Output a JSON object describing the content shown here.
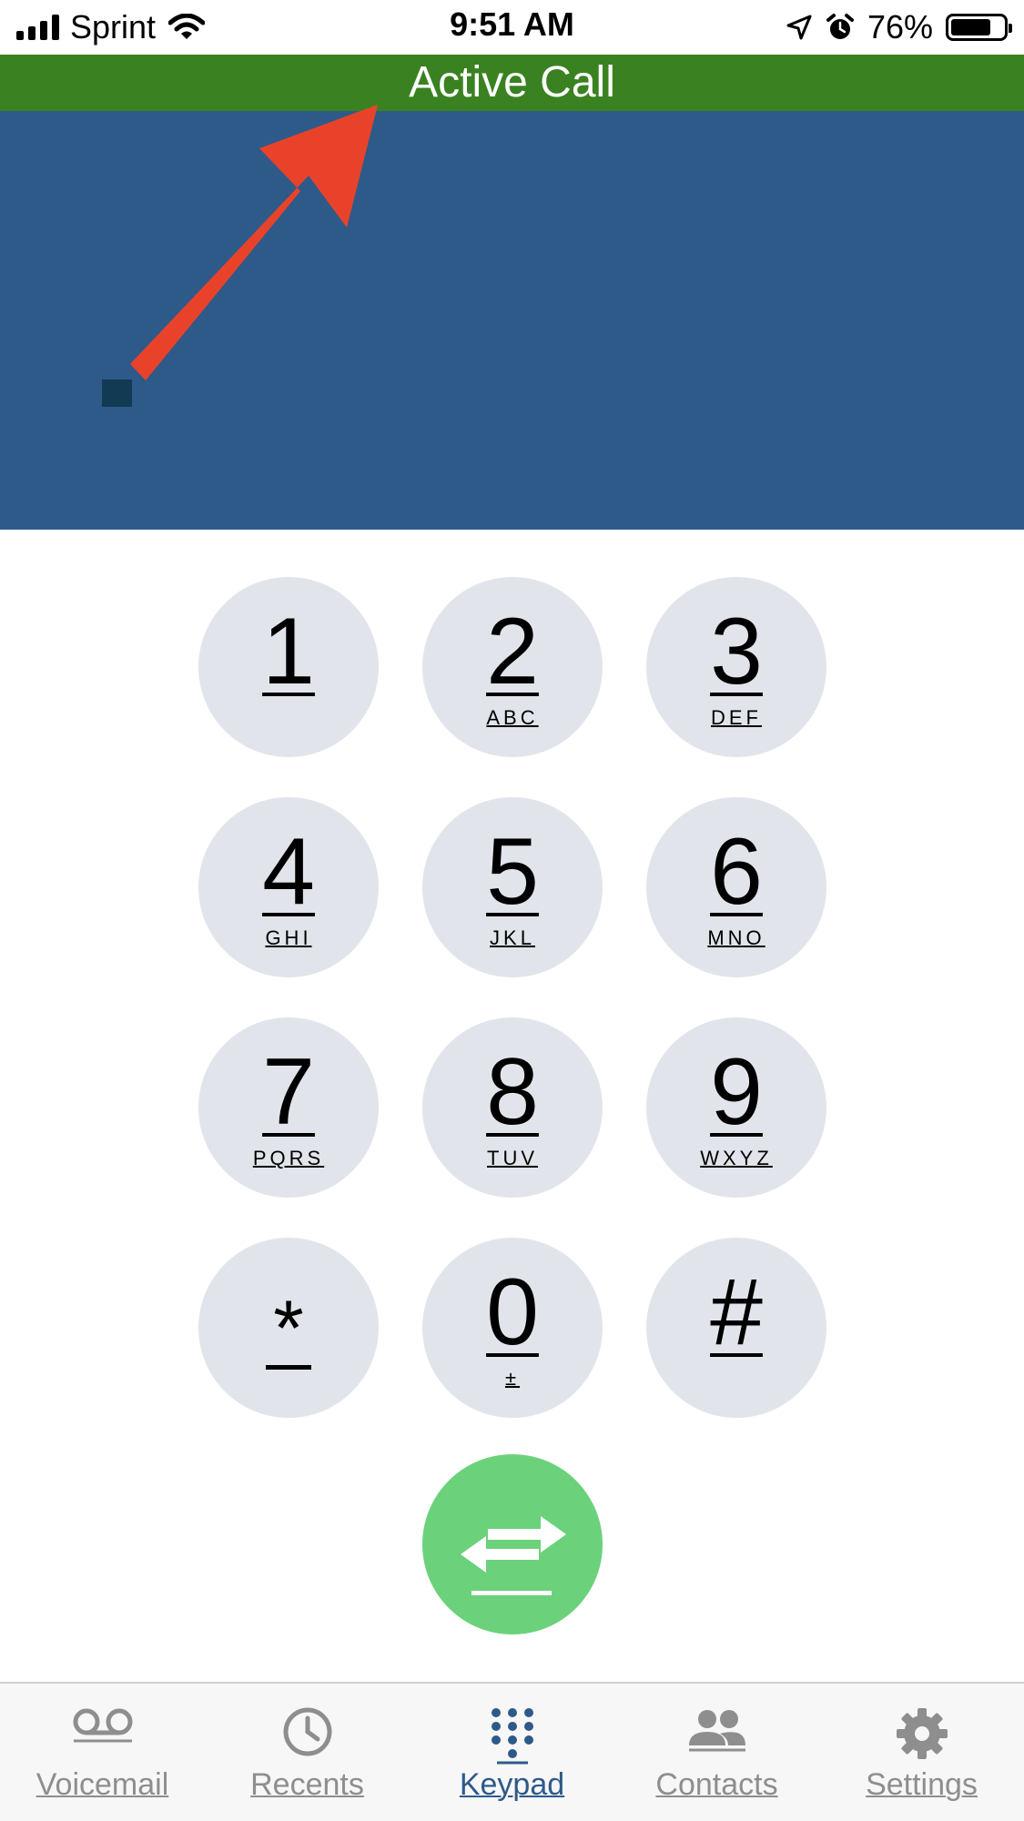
{
  "status_bar": {
    "carrier": "Sprint",
    "time": "9:51 AM",
    "battery_percent": "76%",
    "battery_level": 0.76,
    "icons": [
      "signal-icon",
      "wifi-icon",
      "location-arrow-icon",
      "alarm-icon",
      "battery-icon"
    ]
  },
  "banner": {
    "title": "Active Call",
    "color": "#3a8221"
  },
  "call_panel": {
    "color": "#2e5a89",
    "annotation_color": "#e8432a"
  },
  "keypad": {
    "keys": [
      {
        "digit": "1",
        "letters": ""
      },
      {
        "digit": "2",
        "letters": "ABC"
      },
      {
        "digit": "3",
        "letters": "DEF"
      },
      {
        "digit": "4",
        "letters": "GHI"
      },
      {
        "digit": "5",
        "letters": "JKL"
      },
      {
        "digit": "6",
        "letters": "MNO"
      },
      {
        "digit": "7",
        "letters": "PQRS"
      },
      {
        "digit": "8",
        "letters": "TUV"
      },
      {
        "digit": "9",
        "letters": "WXYZ"
      },
      {
        "digit": "*",
        "letters": ""
      },
      {
        "digit": "0",
        "letters": "±"
      },
      {
        "digit": "#",
        "letters": ""
      }
    ],
    "key_color": "#e1e5eb",
    "transfer_button_color": "#6bd27b",
    "transfer_icon": "transfer-arrows-icon"
  },
  "tab_bar": {
    "tabs": [
      {
        "label": "Voicemail",
        "icon": "voicemail-icon",
        "active": false
      },
      {
        "label": "Recents",
        "icon": "clock-icon",
        "active": false
      },
      {
        "label": "Keypad",
        "icon": "keypad-icon",
        "active": true
      },
      {
        "label": "Contacts",
        "icon": "contacts-icon",
        "active": false
      },
      {
        "label": "Settings",
        "icon": "gear-icon",
        "active": false
      }
    ],
    "active_color": "#2e5a89",
    "inactive_color": "#8e8e8e"
  }
}
